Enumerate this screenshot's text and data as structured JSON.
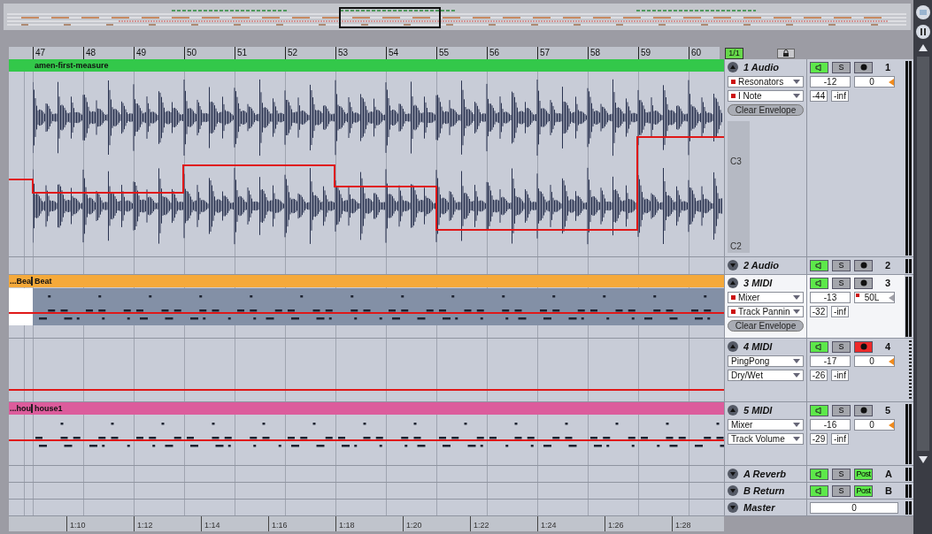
{
  "ruler": {
    "bars": [
      "47",
      "48",
      "49",
      "50",
      "51",
      "52",
      "53",
      "54",
      "55",
      "56",
      "57",
      "58",
      "59",
      "60"
    ],
    "quantize": "1/1"
  },
  "tracks": [
    {
      "kind": "audio",
      "name": "1 Audio",
      "number": "1",
      "expanded": true,
      "selected": false,
      "active": true,
      "armed": false,
      "solo": "S",
      "clip": {
        "name": "amen-first-measure",
        "color": "#33c84a"
      },
      "device": {
        "label": "Resonators",
        "automated": true
      },
      "parameter": {
        "label": "I Note",
        "automated": true
      },
      "volume": "-12",
      "pan": {
        "value": "0",
        "automated": false
      },
      "peak": "-44",
      "output": "-inf",
      "clear_envelope": "Clear Envelope",
      "pitch_labels": [
        "C3",
        "C2"
      ]
    },
    {
      "name": "2 Audio",
      "number": "2",
      "expanded": false,
      "selected": false,
      "active": true,
      "armed": false,
      "solo": "S"
    },
    {
      "kind": "midi",
      "name": "3 MIDI",
      "number": "3",
      "expanded": true,
      "selected": true,
      "active": true,
      "armed": false,
      "solo": "S",
      "clip": {
        "prefix": "...Bea",
        "name": "Beat",
        "color": "#f5a93a"
      },
      "device": {
        "label": "Mixer",
        "automated": true
      },
      "parameter": {
        "label": "Track Pannin",
        "automated": true
      },
      "volume": "-13",
      "pan": {
        "value": "50L",
        "automated": true
      },
      "peak": "-32",
      "output": "-inf",
      "clear_envelope": "Clear Envelope"
    },
    {
      "kind": "midi",
      "name": "4 MIDI",
      "number": "4",
      "expanded": true,
      "selected": false,
      "active": true,
      "armed": true,
      "solo": "S",
      "device": {
        "label": "PingPong",
        "automated": false
      },
      "parameter": {
        "label": "Dry/Wet",
        "automated": false
      },
      "volume": "-17",
      "pan": {
        "value": "0",
        "automated": false
      },
      "peak": "-26",
      "output": "-inf"
    },
    {
      "kind": "midi",
      "name": "5 MIDI",
      "number": "5",
      "expanded": true,
      "selected": false,
      "active": true,
      "armed": false,
      "solo": "S",
      "clip": {
        "prefix": "...hou",
        "name": "house1",
        "color": "#dc5c9c"
      },
      "device": {
        "label": "Mixer",
        "automated": false
      },
      "parameter": {
        "label": "Track Volume",
        "automated": false
      },
      "volume": "-16",
      "pan": {
        "value": "0",
        "automated": false
      },
      "peak": "-29",
      "output": "-inf"
    }
  ],
  "returns": [
    {
      "name": "A Reverb",
      "letter": "A",
      "active": true,
      "solo": "S",
      "post": "Post"
    },
    {
      "name": "B Return",
      "letter": "B",
      "active": true,
      "solo": "S",
      "post": "Post"
    }
  ],
  "master": {
    "name": "Master",
    "volume": "0"
  },
  "time_ruler": [
    "1:10",
    "1:12",
    "1:14",
    "1:16",
    "1:18",
    "1:20",
    "1:22",
    "1:24",
    "1:26",
    "1:28"
  ]
}
